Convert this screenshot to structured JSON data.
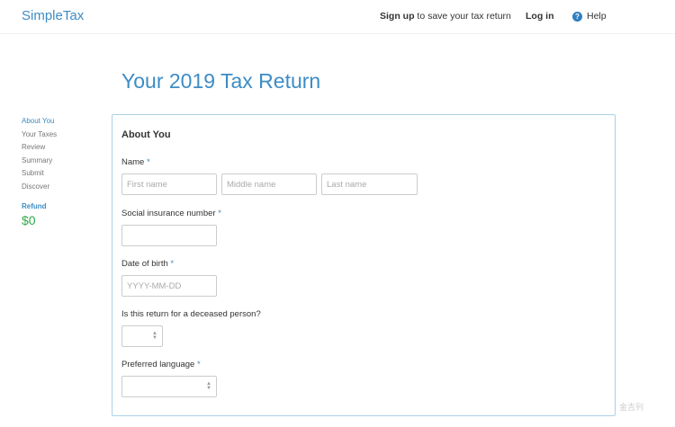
{
  "header": {
    "logo": "SimpleTax",
    "signup_bold": "Sign up",
    "signup_rest": " to save your tax return",
    "login": "Log in",
    "help": "Help",
    "help_icon_glyph": "?"
  },
  "page_title": "Your 2019 Tax Return",
  "sidebar": {
    "items": [
      {
        "label": "About You"
      },
      {
        "label": "Your Taxes"
      },
      {
        "label": "Review"
      },
      {
        "label": "Summary"
      },
      {
        "label": "Submit"
      },
      {
        "label": "Discover"
      }
    ],
    "active_index": 0,
    "refund_label": "Refund",
    "refund_value": "$0"
  },
  "form": {
    "section_title": "About You",
    "name": {
      "label": "Name",
      "required_mark": "*",
      "first_placeholder": "First name",
      "middle_placeholder": "Middle name",
      "last_placeholder": "Last name"
    },
    "sin": {
      "label": "Social insurance number",
      "required_mark": "*",
      "value": ""
    },
    "dob": {
      "label": "Date of birth",
      "required_mark": "*",
      "placeholder": "YYYY-MM-DD"
    },
    "deceased": {
      "label": "Is this return for a deceased person?",
      "selected": ""
    },
    "language": {
      "label": "Preferred language",
      "required_mark": "*",
      "selected": ""
    }
  },
  "watermark": "金吉列",
  "colors": {
    "accent": "#3d8cc4",
    "refund": "#2eaa4a",
    "card_border": "#a9d1e6"
  }
}
